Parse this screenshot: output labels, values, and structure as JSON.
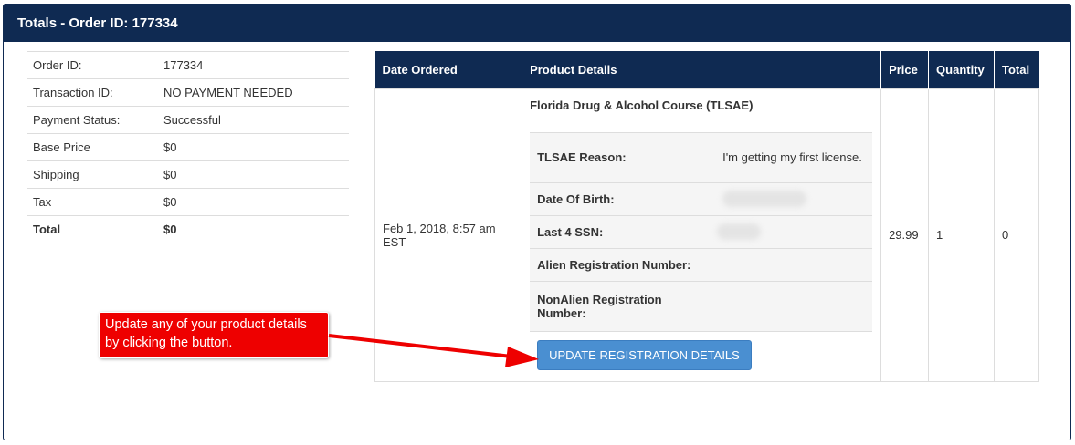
{
  "panel": {
    "title": "Totals - Order ID: 177334"
  },
  "summary": {
    "rows": [
      {
        "label": "Order ID:",
        "value": "177334"
      },
      {
        "label": "Transaction ID:",
        "value": "NO PAYMENT NEEDED"
      },
      {
        "label": "Payment Status:",
        "value": "Successful"
      },
      {
        "label": "Base Price",
        "value": "$0"
      },
      {
        "label": "Shipping",
        "value": "$0"
      },
      {
        "label": "Tax",
        "value": "$0"
      },
      {
        "label": "Total",
        "value": "$0"
      }
    ]
  },
  "order": {
    "headers": {
      "date": "Date Ordered",
      "product": "Product Details",
      "price": "Price",
      "quantity": "Quantity",
      "total": "Total"
    },
    "row": {
      "date": "Feb 1, 2018, 8:57 am EST",
      "product_name": "Florida Drug & Alcohol Course (TLSAE)",
      "price": "29.99",
      "quantity": "1",
      "total": "0"
    },
    "attributes": [
      {
        "label": "TLSAE Reason:",
        "value": "I'm getting my first license."
      },
      {
        "label": "Date Of Birth:",
        "value": ""
      },
      {
        "label": "Last 4 SSN:",
        "value": ""
      },
      {
        "label": "Alien Registration Number:",
        "value": ""
      },
      {
        "label": "NonAlien Registration Number:",
        "value": ""
      }
    ],
    "update_button": "UPDATE REGISTRATION DETAILS"
  },
  "callout": {
    "text": "Update any of your product details by clicking the button."
  },
  "colors": {
    "header": "#0f2a52",
    "button": "#4a8fd1",
    "callout": "#ee0000"
  }
}
